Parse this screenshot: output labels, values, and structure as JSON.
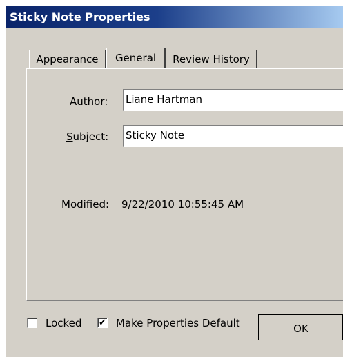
{
  "window": {
    "title": "Sticky Note Properties"
  },
  "tabs": [
    {
      "label": "Appearance",
      "active": false
    },
    {
      "label": "General",
      "active": true
    },
    {
      "label": "Review History",
      "active": false
    }
  ],
  "general": {
    "author_label_underlined": "A",
    "author_label_rest": "uthor:",
    "author_value": "Liane Hartman",
    "subject_label_underlined": "S",
    "subject_label_rest": "ubject:",
    "subject_value": "Sticky Note",
    "modified_label": "Modified:",
    "modified_value": "9/22/2010 10:55:45 AM"
  },
  "footer": {
    "locked_label": "Locked",
    "locked_checked": false,
    "make_default_label": "Make Properties Default",
    "make_default_checked": true,
    "check_glyph": "✔",
    "ok_label": "OK"
  }
}
